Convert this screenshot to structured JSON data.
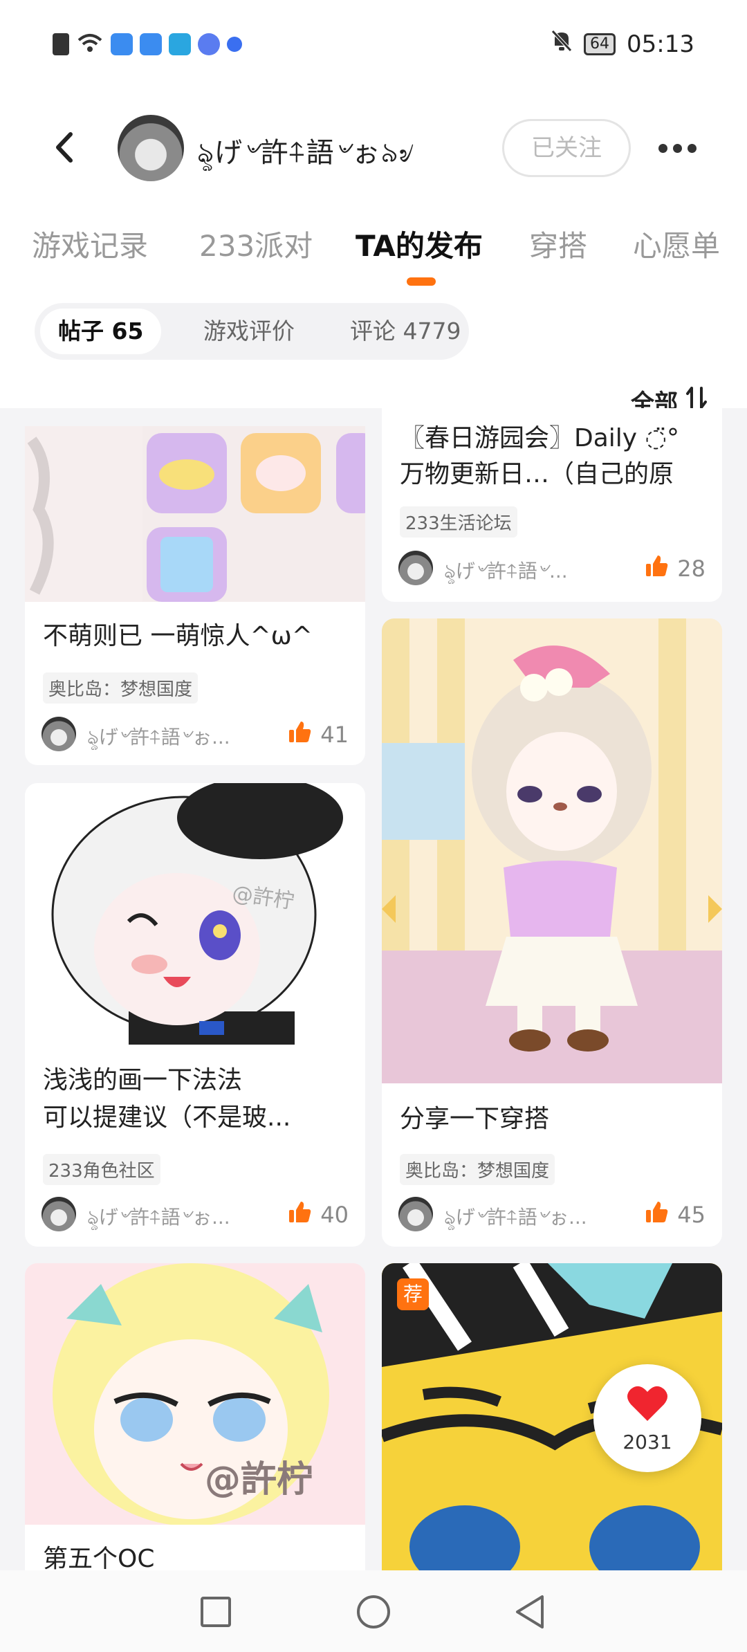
{
  "status_bar": {
    "time": "05:13",
    "battery": "64"
  },
  "header": {
    "username": "ৡげ৺許⍏語৺ぉ৯৶",
    "follow_label": "已关注"
  },
  "tabs": [
    {
      "label": "游戏记录"
    },
    {
      "label": "233派对"
    },
    {
      "label": "TA的发布"
    },
    {
      "label": "穿搭"
    },
    {
      "label": "心愿单"
    }
  ],
  "subtabs": [
    {
      "label": "帖子 65"
    },
    {
      "label": "游戏评价"
    },
    {
      "label": "评论 4779"
    }
  ],
  "sort_label": "全部",
  "posts": [
    {
      "title": "不萌则已 一萌惊人^ω^",
      "tag": "奥比岛：梦想国度",
      "author": "ৡげ৺許⍏語৺ぉ...",
      "likes": "41"
    },
    {
      "title_line1": "〖春日游园会〗Daily ◌̈°",
      "title_line2": "万物更新日…（自己的原",
      "tag": "233生活论坛",
      "author": "ৡげ৺許⍏語৺...",
      "likes": "28"
    },
    {
      "title_line1": "浅浅的画一下法法",
      "title_line2": "可以提建议（不是玻...",
      "tag": "233角色社区",
      "author": "ৡげ৺許⍏語৺ぉ...",
      "likes": "40",
      "watermark": "@許柠"
    },
    {
      "title": "分享一下穿搭",
      "tag": "奥比岛：梦想国度",
      "author": "ৡげ৺許⍏語৺ぉ...",
      "likes": "45"
    },
    {
      "title": "第五个OC",
      "watermark": "@許柠"
    },
    {
      "badge": "荐"
    }
  ],
  "fav_count": "2031"
}
